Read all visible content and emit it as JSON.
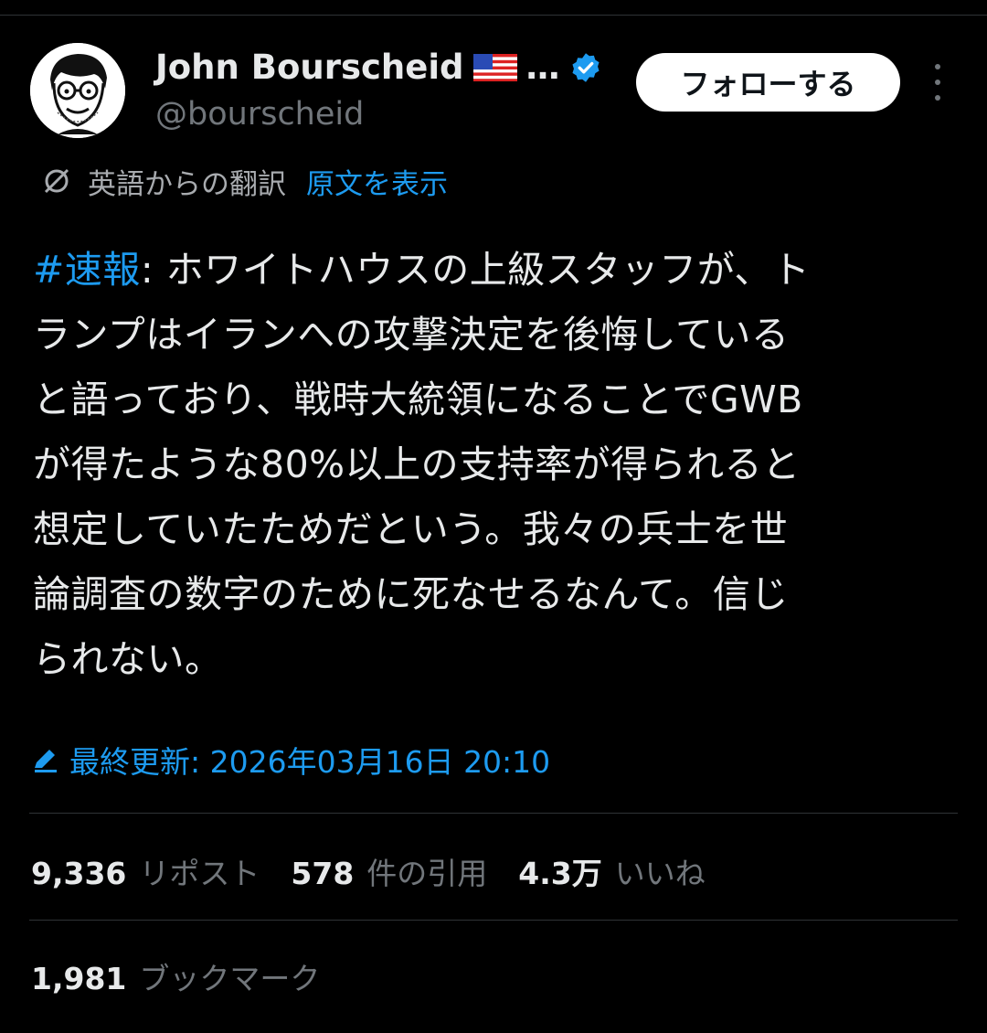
{
  "author": {
    "name": "John Bourscheid",
    "name_ellipsis": "…",
    "handle": "@bourscheid",
    "flag_icon": "us-flag-icon",
    "verified_icon": "verified-badge-icon"
  },
  "actions": {
    "follow_label": "フォローする",
    "more_icon": "more-options-icon"
  },
  "translation": {
    "label": "英語からの翻訳",
    "show_original": "原文を表示"
  },
  "tweet": {
    "hashtag": "#速報",
    "text": ": ホワイトハウスの上級スタッフが、トランプはイランへの攻撃決定を後悔していると語っており、戦時大統領になることでGWBが得たような80%以上の支持率が得られると想定していたためだという。我々の兵士を世論調査の数字のために死なせるなんて。信じられない。",
    "lines": [
      ": ホワイトハウスの上級スタッフが、ト",
      "ランプはイランへの攻撃決定を後悔している",
      "と語っており、戦時大統領になることでGWB",
      "が得たような80%以上の支持率が得られると",
      "想定していたためだという。我々の兵士を世",
      "論調査の数字のために死なせるなんて。信じ",
      "られない。"
    ]
  },
  "edited": {
    "label": "最終更新: 2026年03月16日 20:10"
  },
  "stats": {
    "reposts_count": "9,336",
    "reposts_label": "リポスト",
    "quotes_count": "578",
    "quotes_label": "件の引用",
    "likes_count": "4.3万",
    "likes_label": "いいね",
    "bookmarks_count": "1,981",
    "bookmarks_label": "ブックマーク"
  },
  "colors": {
    "background": "#000000",
    "text": "#e7e9ea",
    "muted": "#71767b",
    "accent": "#1d9bf0"
  }
}
